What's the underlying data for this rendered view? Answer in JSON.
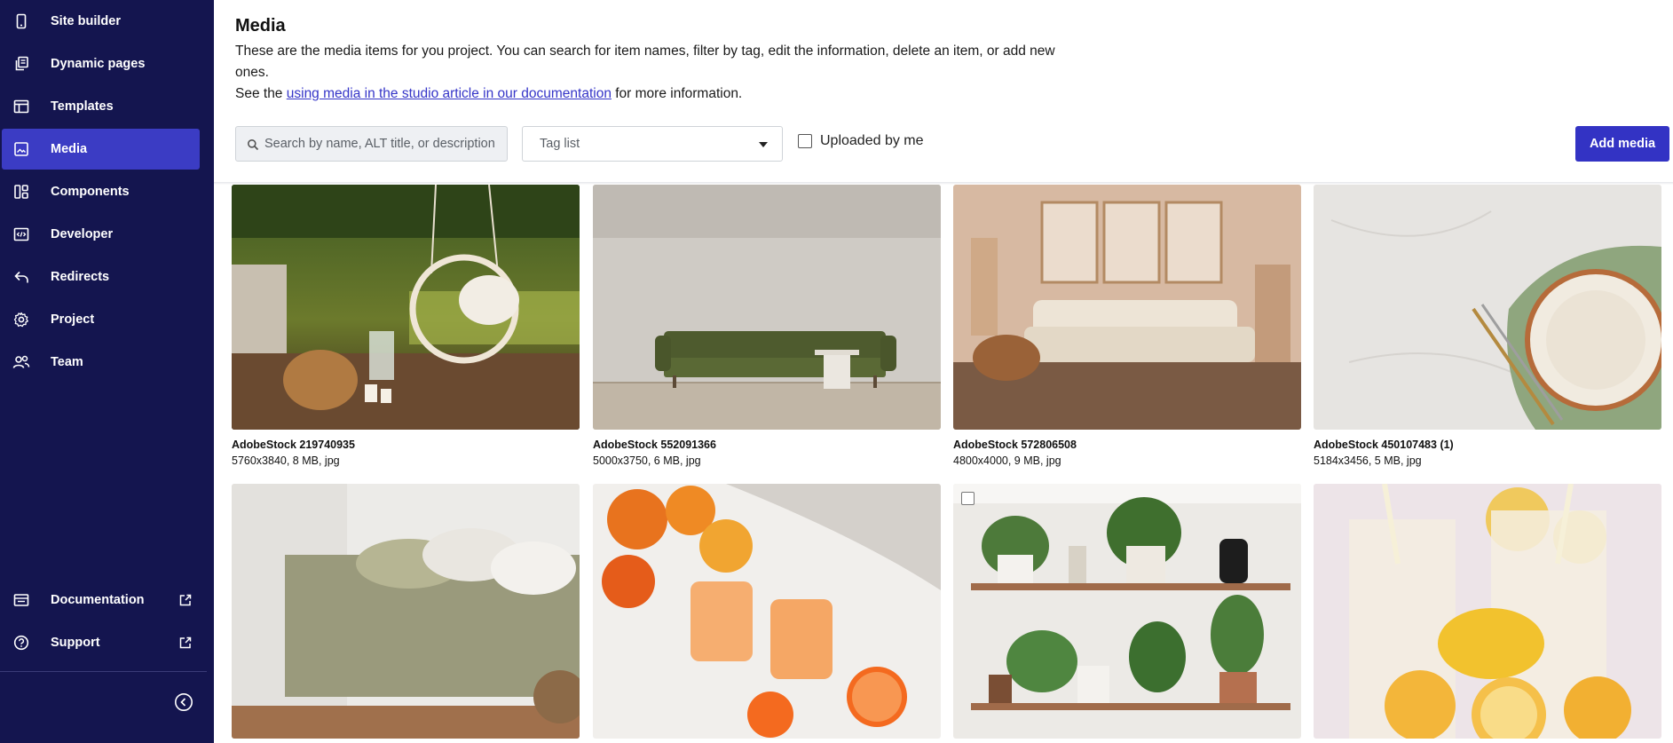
{
  "sidebar": {
    "items": [
      {
        "label": "Site builder",
        "icon": "mobile-icon",
        "active": false
      },
      {
        "label": "Dynamic pages",
        "icon": "pages-stack-icon",
        "active": false
      },
      {
        "label": "Templates",
        "icon": "template-layout-icon",
        "active": false
      },
      {
        "label": "Media",
        "icon": "image-icon",
        "active": true
      },
      {
        "label": "Components",
        "icon": "components-grid-icon",
        "active": false
      },
      {
        "label": "Developer",
        "icon": "code-icon",
        "active": false
      },
      {
        "label": "Redirects",
        "icon": "redirect-arrow-icon",
        "active": false
      },
      {
        "label": "Project",
        "icon": "gear-icon",
        "active": false
      },
      {
        "label": "Team",
        "icon": "users-icon",
        "active": false
      }
    ],
    "footer_items": [
      {
        "label": "Documentation",
        "icon": "book-icon",
        "external": true
      },
      {
        "label": "Support",
        "icon": "help-circle-icon",
        "external": true
      }
    ],
    "collapse_icon": "chevron-left-circle-icon"
  },
  "header": {
    "title": "Media",
    "intro_line1": "These are the media items for you project. You can search for item names, filter by tag, edit the information, delete an item, or add new ones.",
    "intro_see": "See the ",
    "intro_link": "using media in the studio article in our documentation",
    "intro_after": " for more information."
  },
  "toolbar": {
    "search_placeholder": "Search by name, ALT title, or description",
    "tag_select_value": "Tag list",
    "uploaded_by_me_label": "Uploaded by me",
    "add_media_label": "Add media"
  },
  "media_items": [
    {
      "name": "AdobeStock 219740935",
      "meta": "5760x3840, 8 MB, jpg",
      "scene": "hanging-chair-garden"
    },
    {
      "name": "AdobeStock 552091366",
      "meta": "5000x3750, 6 MB, jpg",
      "scene": "green-sofa"
    },
    {
      "name": "AdobeStock 572806508",
      "meta": "4800x4000, 9 MB, jpg",
      "scene": "beige-living-room"
    },
    {
      "name": "AdobeStock 450107483 (1)",
      "meta": "5184x3456, 5 MB, jpg",
      "scene": "plate-on-marble"
    },
    {
      "name": "",
      "meta": "",
      "scene": "green-bedding"
    },
    {
      "name": "",
      "meta": "",
      "scene": "orange-drinks"
    },
    {
      "name": "",
      "meta": "",
      "scene": "plant-shelves"
    },
    {
      "name": "",
      "meta": "",
      "scene": "lemonade"
    }
  ],
  "colors": {
    "sidebar_bg": "#14154f",
    "sidebar_active": "#3b3cc4",
    "primary_button": "#3333c4",
    "link": "#3535c8"
  }
}
